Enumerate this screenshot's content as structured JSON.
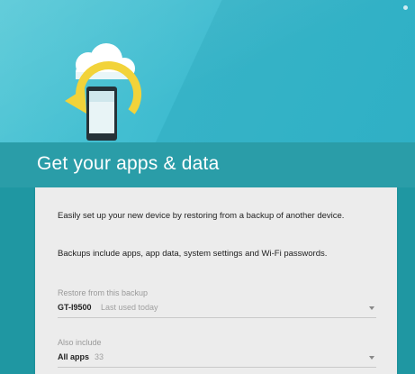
{
  "header": {
    "title": "Get your apps & data"
  },
  "card": {
    "intro": "Easily set up your new device by restoring from a backup of another device.",
    "backups_info": "Backups include apps, app data, system settings and Wi-Fi passwords.",
    "restore": {
      "label": "Restore from this backup",
      "device": "GT-I9500",
      "last_used": "Last used today"
    },
    "also_include": {
      "label": "Also include",
      "value": "All apps",
      "count": "33"
    }
  },
  "icons": {
    "status": "status-dot-icon",
    "illustration": "cloud-restore-phone-icon",
    "dropdown_arrow": "chevron-down-icon"
  },
  "colors": {
    "hero_background": "#3fbcd0",
    "header_background": "#2a9da8",
    "page_background": "#1f97a2",
    "card_background": "#ececec",
    "restore_arrow": "#f2d33a"
  }
}
